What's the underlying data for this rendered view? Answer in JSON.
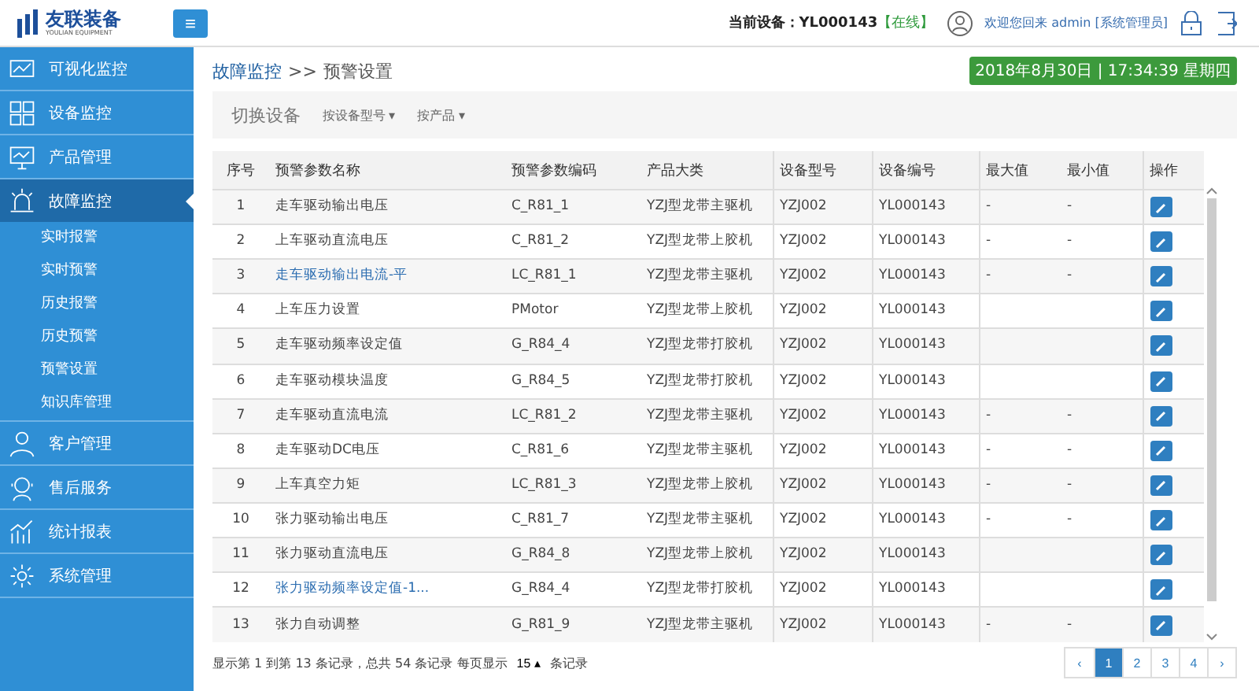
{
  "header": {
    "logo_text": "友联装备",
    "logo_subtext": "YOULIAN EQUIPMENT",
    "menu_toggle": "≡",
    "device_label": "当前设备：YL000143",
    "device_status": "【在线】",
    "welcome": "欢迎您回来 admin [系统管理员]"
  },
  "sidebar": {
    "items": [
      {
        "label": "可视化监控",
        "selected": false
      },
      {
        "label": "设备监控",
        "selected": false
      },
      {
        "label": "产品管理",
        "selected": false
      },
      {
        "label": "故障监控",
        "selected": true,
        "expanded": true,
        "children": [
          {
            "label": "实时报警",
            "selected": false
          },
          {
            "label": "实时预警",
            "selected": false
          },
          {
            "label": "历史报警",
            "selected": false
          },
          {
            "label": "历史预警",
            "selected": false
          },
          {
            "label": "预警设置",
            "selected": false
          },
          {
            "label": "知识库管理",
            "selected": false
          }
        ]
      },
      {
        "label": "客户管理",
        "selected": false
      },
      {
        "label": "售后服务",
        "selected": false
      },
      {
        "label": "统计报表",
        "selected": false
      },
      {
        "label": "系统管理",
        "selected": false
      }
    ]
  },
  "breadcrumb": {
    "parent": "故障监控",
    "separator": ">>",
    "current": "预警设置"
  },
  "datetime": "2018年8月30日 | 17:34:39 星期四",
  "toolbar": {
    "title": "切换设备",
    "filters": [
      "按设备型号 ▾",
      "按产品 ▾"
    ]
  },
  "table": {
    "columns": [
      "序号",
      "预警参数名称",
      "预警参数编码",
      "产品大类",
      "设备型号",
      "设备编号",
      "最大值",
      "最小值",
      "操作"
    ],
    "rows": [
      {
        "cells": [
          "1",
          "走车驱动输出电压",
          "C_R81_1",
          "YZJ型龙带主驱机",
          "YZJ002",
          "YL000143",
          "-",
          "-"
        ],
        "link": false
      },
      {
        "cells": [
          "2",
          "上车驱动直流电压",
          "C_R81_2",
          "YZJ型龙带上胶机",
          "YZJ002",
          "YL000143",
          "-",
          "-"
        ],
        "link": false
      },
      {
        "cells": [
          "3",
          "走车驱动输出电流-平",
          "LC_R81_1",
          "YZJ型龙带主驱机",
          "YZJ002",
          "YL000143",
          "-",
          "-"
        ],
        "link": true
      },
      {
        "cells": [
          "4",
          "上车压力设置",
          "PMotor",
          "YZJ型龙带上胶机",
          "YZJ002",
          "YL000143",
          "",
          ""
        ],
        "link": false
      },
      {
        "cells": [
          "5",
          "走车驱动频率设定值",
          "G_R84_4",
          "YZJ型龙带打胶机",
          "YZJ002",
          "YL000143",
          "",
          ""
        ],
        "link": false
      },
      {
        "cells": [
          "6",
          "走车驱动模块温度",
          "G_R84_5",
          "YZJ型龙带打胶机",
          "YZJ002",
          "YL000143",
          "",
          ""
        ],
        "link": false
      },
      {
        "cells": [
          "7",
          "走车驱动直流电流",
          "LC_R81_2",
          "YZJ型龙带主驱机",
          "YZJ002",
          "YL000143",
          "-",
          "-"
        ],
        "link": false
      },
      {
        "cells": [
          "8",
          "走车驱动DC电压",
          "C_R81_6",
          "YZJ型龙带主驱机",
          "YZJ002",
          "YL000143",
          "-",
          "-"
        ],
        "link": false
      },
      {
        "cells": [
          "9",
          "上车真空力矩",
          "LC_R81_3",
          "YZJ型龙带上胶机",
          "YZJ002",
          "YL000143",
          "-",
          "-"
        ],
        "link": false
      },
      {
        "cells": [
          "10",
          "张力驱动输出电压",
          "C_R81_7",
          "YZJ型龙带主驱机",
          "YZJ002",
          "YL000143",
          "-",
          "-"
        ],
        "link": false
      },
      {
        "cells": [
          "11",
          "张力驱动直流电压",
          "G_R84_8",
          "YZJ型龙带上胶机",
          "YZJ002",
          "YL000143",
          "",
          ""
        ],
        "link": false
      },
      {
        "cells": [
          "12",
          "张力驱动频率设定值-1...",
          "G_R84_4",
          "YZJ型龙带打胶机",
          "YZJ002",
          "YL000143",
          "",
          ""
        ],
        "link": true
      },
      {
        "cells": [
          "13",
          "张力自动调整",
          "G_R81_9",
          "YZJ型龙带主驱机",
          "YZJ002",
          "YL000143",
          "-",
          "-"
        ],
        "link": false
      }
    ]
  },
  "footer": {
    "summary": "显示第 1 到第 13 条记录，总共 54 条记录 每页显示",
    "page_size": "15 ▴",
    "suffix": "条记录",
    "pages": [
      {
        "label": "‹",
        "selected": false
      },
      {
        "label": "1",
        "selected": true
      },
      {
        "label": "2",
        "selected": false
      },
      {
        "label": "3",
        "selected": false
      },
      {
        "label": "4",
        "selected": false
      },
      {
        "label": "›",
        "selected": false
      }
    ]
  }
}
